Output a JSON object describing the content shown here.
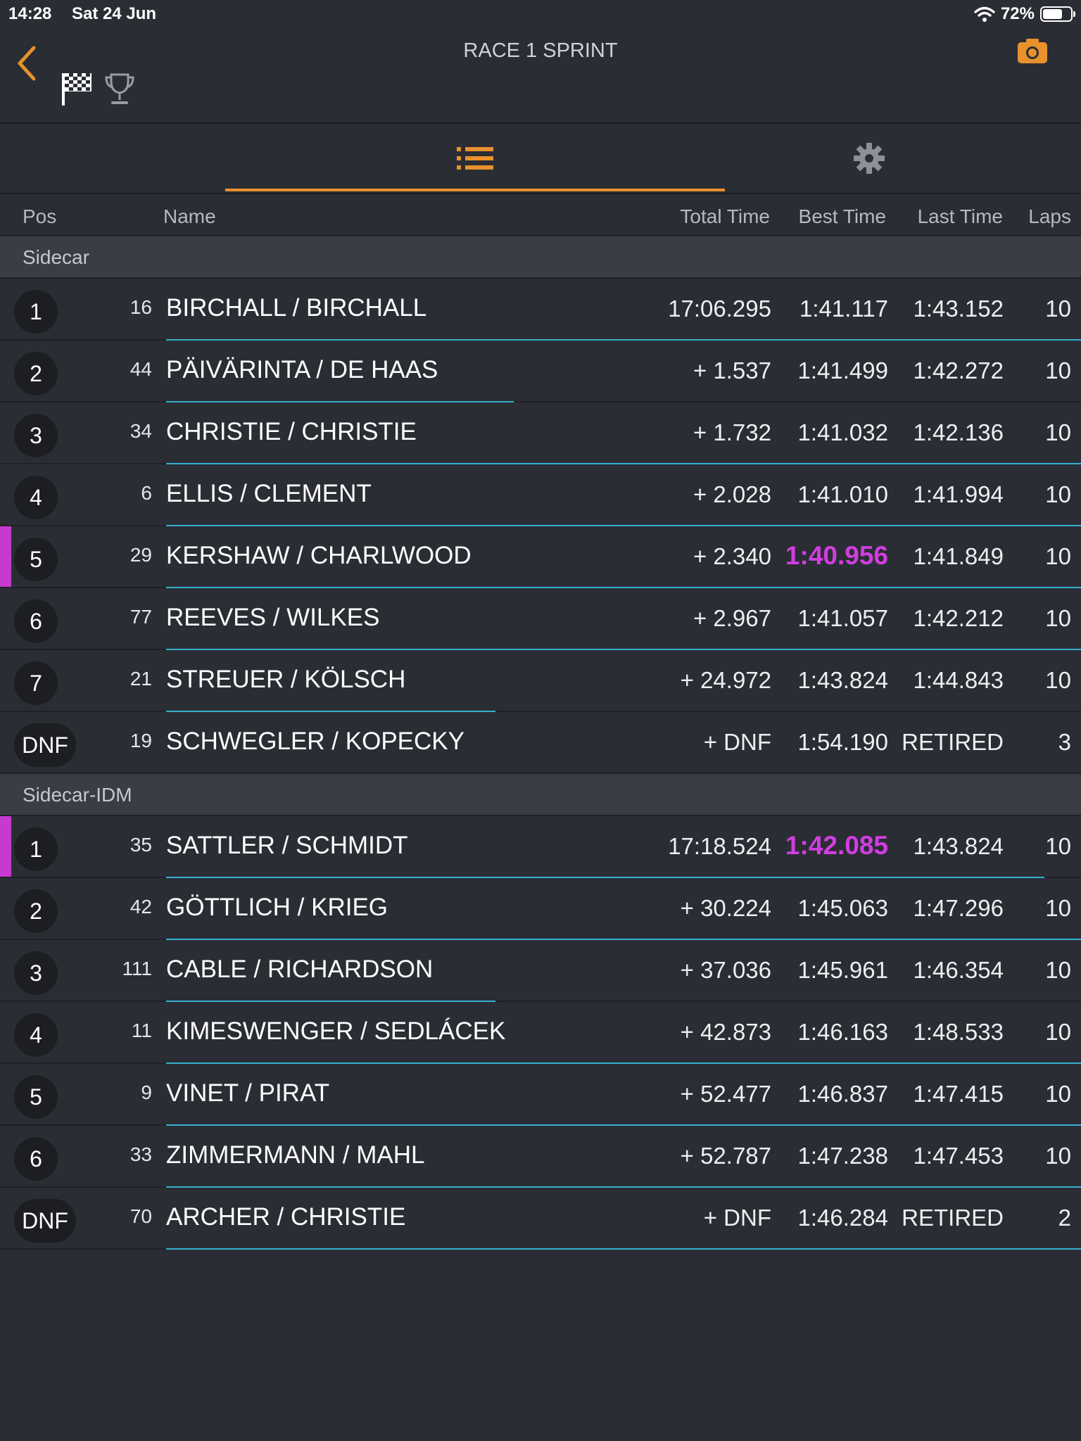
{
  "status": {
    "time": "14:28",
    "date": "Sat 24 Jun",
    "battery_pct": "72%",
    "battery_level": 0.72
  },
  "header": {
    "title": "RACE 1 SPRINT"
  },
  "icons": {
    "back": "chevron-left-icon",
    "flag": "checkered-flag-icon",
    "trophy": "trophy-icon",
    "camera": "camera-icon",
    "list": "list-icon",
    "settings": "gear-icon"
  },
  "colors": {
    "accent": "#e8912d",
    "fastest": "#d13ee0",
    "gap_line": "#35b1cf"
  },
  "columns": {
    "pos": "Pos",
    "name": "Name",
    "total": "Total Time",
    "best": "Best Time",
    "last": "Last Time",
    "laps": "Laps"
  },
  "groups": [
    {
      "label": "Sidecar",
      "rows": [
        {
          "pos": "1",
          "num": "16",
          "name": "BIRCHALL / BIRCHALL",
          "total": "17:06.295",
          "best": "1:41.117",
          "last": "1:43.152",
          "laps": "10",
          "fastest": false,
          "marker": false,
          "gap_fraction": 1.0
        },
        {
          "pos": "2",
          "num": "44",
          "name": "PÄIVÄRINTA / DE HAAS",
          "total": "+ 1.537",
          "best": "1:41.499",
          "last": "1:42.272",
          "laps": "10",
          "fastest": false,
          "marker": false,
          "gap_fraction": 0.38
        },
        {
          "pos": "3",
          "num": "34",
          "name": "CHRISTIE / CHRISTIE",
          "total": "+ 1.732",
          "best": "1:41.032",
          "last": "1:42.136",
          "laps": "10",
          "fastest": false,
          "marker": false,
          "gap_fraction": 1.0
        },
        {
          "pos": "4",
          "num": "6",
          "name": "ELLIS / CLEMENT",
          "total": "+ 2.028",
          "best": "1:41.010",
          "last": "1:41.994",
          "laps": "10",
          "fastest": false,
          "marker": false,
          "gap_fraction": 1.0
        },
        {
          "pos": "5",
          "num": "29",
          "name": "KERSHAW / CHARLWOOD",
          "total": "+ 2.340",
          "best": "1:40.956",
          "last": "1:41.849",
          "laps": "10",
          "fastest": true,
          "marker": true,
          "gap_fraction": 1.0
        },
        {
          "pos": "6",
          "num": "77",
          "name": "REEVES / WILKES",
          "total": "+ 2.967",
          "best": "1:41.057",
          "last": "1:42.212",
          "laps": "10",
          "fastest": false,
          "marker": false,
          "gap_fraction": 1.0
        },
        {
          "pos": "7",
          "num": "21",
          "name": "STREUER / KÖLSCH",
          "total": "+ 24.972",
          "best": "1:43.824",
          "last": "1:44.843",
          "laps": "10",
          "fastest": false,
          "marker": false,
          "gap_fraction": 0.36
        },
        {
          "pos": "DNF",
          "num": "19",
          "name": "SCHWEGLER / KOPECKY",
          "total": "+ DNF",
          "best": "1:54.190",
          "last": "RETIRED",
          "laps": "3",
          "fastest": false,
          "marker": false,
          "gap_fraction": 0
        }
      ]
    },
    {
      "label": "Sidecar-IDM",
      "rows": [
        {
          "pos": "1",
          "num": "35",
          "name": "SATTLER / SCHMIDT",
          "total": "17:18.524",
          "best": "1:42.085",
          "last": "1:43.824",
          "laps": "10",
          "fastest": true,
          "marker": true,
          "gap_fraction": 0.96
        },
        {
          "pos": "2",
          "num": "42",
          "name": "GÖTTLICH / KRIEG",
          "total": "+ 30.224",
          "best": "1:45.063",
          "last": "1:47.296",
          "laps": "10",
          "fastest": false,
          "marker": false,
          "gap_fraction": 1.0
        },
        {
          "pos": "3",
          "num": "111",
          "name": "CABLE / RICHARDSON",
          "total": "+ 37.036",
          "best": "1:45.961",
          "last": "1:46.354",
          "laps": "10",
          "fastest": false,
          "marker": false,
          "gap_fraction": 0.36
        },
        {
          "pos": "4",
          "num": "11",
          "name": "KIMESWENGER / SEDLÁCEK",
          "total": "+ 42.873",
          "best": "1:46.163",
          "last": "1:48.533",
          "laps": "10",
          "fastest": false,
          "marker": false,
          "gap_fraction": 1.0
        },
        {
          "pos": "5",
          "num": "9",
          "name": "VINET / PIRAT",
          "total": "+ 52.477",
          "best": "1:46.837",
          "last": "1:47.415",
          "laps": "10",
          "fastest": false,
          "marker": false,
          "gap_fraction": 1.0
        },
        {
          "pos": "6",
          "num": "33",
          "name": "ZIMMERMANN / MAHL",
          "total": "+ 52.787",
          "best": "1:47.238",
          "last": "1:47.453",
          "laps": "10",
          "fastest": false,
          "marker": false,
          "gap_fraction": 1.0
        },
        {
          "pos": "DNF",
          "num": "70",
          "name": "ARCHER / CHRISTIE",
          "total": "+ DNF",
          "best": "1:46.284",
          "last": "RETIRED",
          "laps": "2",
          "fastest": false,
          "marker": false,
          "gap_fraction": 1.0
        }
      ]
    }
  ]
}
